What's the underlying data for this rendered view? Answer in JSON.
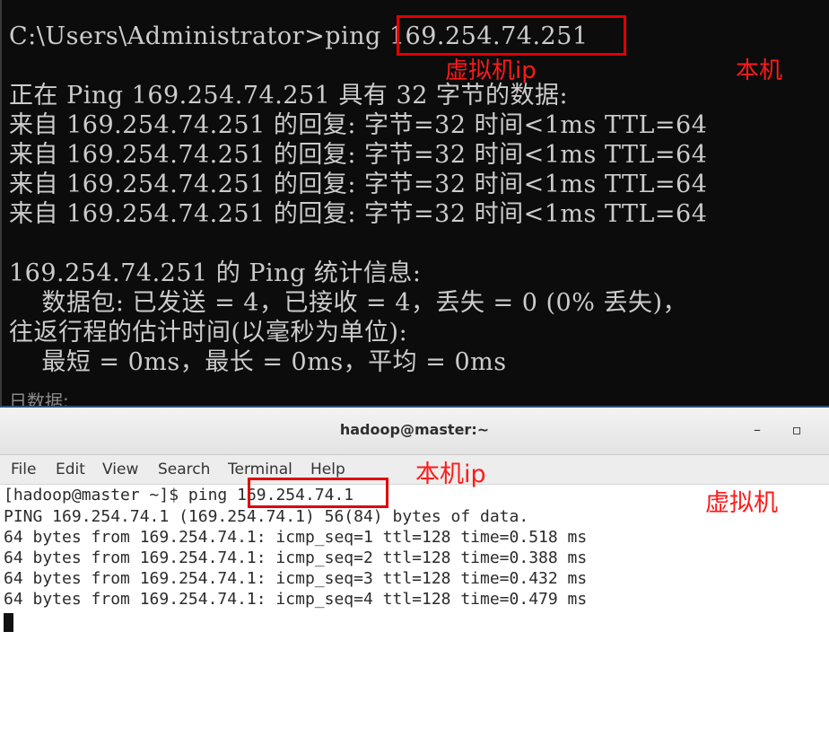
{
  "cmd": {
    "prompt": "C:\\Users\\Administrator>ping ",
    "ping_target": "169.254.74.251",
    "lines": [
      "正在 Ping 169.254.74.251 具有 32 字节的数据:",
      "来自 169.254.74.251 的回复: 字节=32 时间<1ms TTL=64",
      "来自 169.254.74.251 的回复: 字节=32 时间<1ms TTL=64",
      "来自 169.254.74.251 的回复: 字节=32 时间<1ms TTL=64",
      "来自 169.254.74.251 的回复: 字节=32 时间<1ms TTL=64",
      "169.254.74.251 的 Ping 统计信息:",
      "    数据包: 已发送 = 4，已接收 = 4，丢失 = 0 (0% 丢失)，",
      "往返行程的估计时间(以毫秒为单位):",
      "    最短 = 0ms，最长 = 0ms，平均 = 0ms"
    ],
    "overflow_text": "日数据:"
  },
  "annotations": {
    "vm_ip_label": "虚拟机ip",
    "host_label": "本机",
    "host_ip_label": "本机ip",
    "vm_label": "虚拟机",
    "color": "#ff1a1a"
  },
  "terminal": {
    "title": "hadoop@master:~",
    "minimize_icon": "minimize-icon",
    "maximize_icon": "maximize-icon",
    "menu": [
      "File",
      "Edit",
      "View",
      "Search",
      "Terminal",
      "Help"
    ],
    "prompt": "[hadoop@master ~]$ ping ",
    "ping_target": "169.254.74.1",
    "lines": [
      "PING 169.254.74.1 (169.254.74.1) 56(84) bytes of data.",
      "64 bytes from 169.254.74.1: icmp_seq=1 ttl=128 time=0.518 ms",
      "64 bytes from 169.254.74.1: icmp_seq=2 ttl=128 time=0.388 ms",
      "64 bytes from 169.254.74.1: icmp_seq=3 ttl=128 time=0.432 ms",
      "64 bytes from 169.254.74.1: icmp_seq=4 ttl=128 time=0.479 ms"
    ]
  }
}
